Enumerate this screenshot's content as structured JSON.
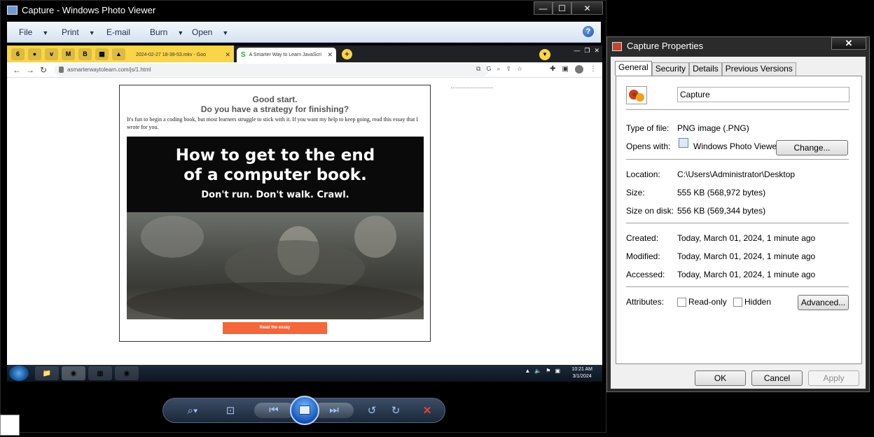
{
  "photo_viewer": {
    "title": "Capture - Windows Photo Viewer",
    "window_buttons": {
      "minimize": "—",
      "maximize": "☐",
      "close": "✕"
    },
    "menu": [
      {
        "label": "File",
        "has_dropdown": true
      },
      {
        "label": "Print",
        "has_dropdown": true
      },
      {
        "label": "E-mail",
        "has_dropdown": false
      },
      {
        "label": "Burn",
        "has_dropdown": true
      },
      {
        "label": "Open",
        "has_dropdown": true
      }
    ],
    "help": "?",
    "image": {
      "browser": {
        "tab1_title": "2024-02-27 18-39-53.mkv - Goo",
        "tab2_title": "A Smarter Way to Learn JavaScri",
        "url": "asmarterwaytolearn.com/js/1.html"
      },
      "modal": {
        "heading1": "Good start.",
        "heading2": "Do you have a strategy for finishing?",
        "text": "It's fun to begin a coding book, but most learners struggle to stick with it. If you want my help to keep going, read this essay that I wrote for you.",
        "banner_line1": "How to get to the end",
        "banner_line2": "of a computer book.",
        "banner_line3": "Don't run. Don't walk. Crawl.",
        "button": "Read the essay"
      },
      "taskbar": {
        "time": "10:21 AM",
        "date": "3/1/2024"
      }
    },
    "controls": [
      {
        "name": "zoom",
        "icon": "magnifier-icon"
      },
      {
        "name": "actual-size",
        "icon": "fit-icon"
      },
      {
        "name": "previous",
        "icon": "previous-icon"
      },
      {
        "name": "slideshow",
        "icon": "slideshow-icon"
      },
      {
        "name": "next",
        "icon": "next-icon"
      },
      {
        "name": "rotate-ccw",
        "icon": "rotate-left-icon"
      },
      {
        "name": "rotate-cw",
        "icon": "rotate-right-icon"
      },
      {
        "name": "delete",
        "icon": "delete-icon"
      }
    ]
  },
  "properties": {
    "title": "Capture Properties",
    "close": "✕",
    "tabs": [
      "General",
      "Security",
      "Details",
      "Previous Versions"
    ],
    "active_tab": "General",
    "file_name": "Capture",
    "type_label": "Type of file:",
    "type_value": "PNG image (.PNG)",
    "opens_label": "Opens with:",
    "opens_value": "Windows Photo Viewer",
    "change_button": "Change...",
    "location_label": "Location:",
    "location_value": "C:\\Users\\Administrator\\Desktop",
    "size_label": "Size:",
    "size_value": "555 KB (568,972 bytes)",
    "size_disk_label": "Size on disk:",
    "size_disk_value": "556 KB (569,344 bytes)",
    "created_label": "Created:",
    "created_value": "Today, March 01, 2024, 1 minute ago",
    "modified_label": "Modified:",
    "modified_value": "Today, March 01, 2024, 1 minute ago",
    "accessed_label": "Accessed:",
    "accessed_value": "Today, March 01, 2024, 1 minute ago",
    "attributes_label": "Attributes:",
    "readonly_label": "Read-only",
    "hidden_label": "Hidden",
    "advanced_button": "Advanced...",
    "ok_button": "OK",
    "cancel_button": "Cancel",
    "apply_button": "Apply"
  },
  "colors": {
    "accent_orange": "#f5663a",
    "chrome_yellow": "#fad54a"
  }
}
